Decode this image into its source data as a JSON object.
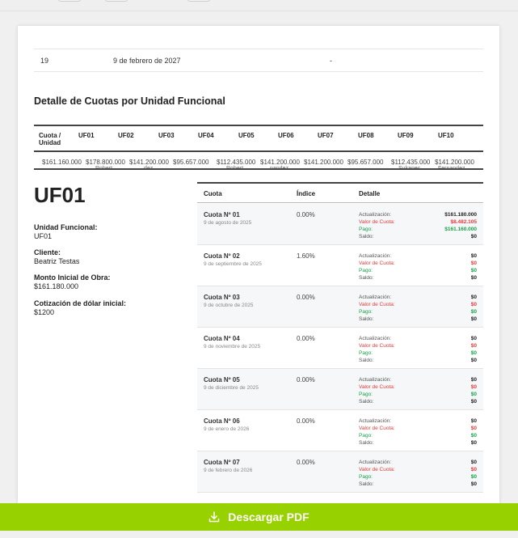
{
  "previous_row": {
    "number": "19",
    "date": "9 de febrero de 2027",
    "value": "-"
  },
  "section_title": "Detalle de Cuotas por Unidad Funcional",
  "uf_table": {
    "headers": [
      "Cuota / Unidad",
      "UF01",
      "UF02",
      "UF03",
      "UF04",
      "UF05",
      "UF06",
      "UF07",
      "UF08",
      "UF09",
      "UF10"
    ],
    "overlapped_values": [
      "$161.160.000",
      "$178.800.000",
      "$141.200.000",
      "$95.657.000",
      "$112.435.000",
      "$141.200.000",
      "$141.200.000",
      "$95.657.000",
      "$112.435.000",
      "$141.200.000"
    ],
    "overlapped_subtexts": [
      "Robert",
      "dez",
      "Robert",
      "nandez",
      "Sukanec",
      "Fernandez"
    ]
  },
  "unit": {
    "title": "UF01",
    "fields": [
      {
        "label": "Unidad Funcional:",
        "value": "UF01"
      },
      {
        "label": "Cliente:",
        "value": "Beatriz Testas"
      },
      {
        "label": "Monto Inicial de Obra:",
        "value": "$161.180.000"
      },
      {
        "label": "Cotización de dólar inicial:",
        "value": "$1200"
      }
    ]
  },
  "cuotas_table": {
    "headers": {
      "cuota": "Cuota",
      "indice": "Índice",
      "detalle": "Detalle"
    },
    "detail_labels": {
      "act": "Actualización:",
      "valor": "Valor de Cuota:",
      "pago": "Pago:",
      "saldo": "Saldo:"
    },
    "rows": [
      {
        "name": "Cuota Nº 01",
        "date": "9 de agosto de 2025",
        "index": "0.00%",
        "act": "$161.180.000",
        "valor": "$8.482.105",
        "pago": "$161.160.000",
        "saldo": "$0"
      },
      {
        "name": "Cuota Nº 02",
        "date": "9 de septiembre de 2025",
        "index": "1.60%",
        "act": "$0",
        "valor": "$0",
        "pago": "$0",
        "saldo": "$0"
      },
      {
        "name": "Cuota Nº 03",
        "date": "9 de octubre de 2025",
        "index": "0.00%",
        "act": "$0",
        "valor": "$0",
        "pago": "$0",
        "saldo": "$0"
      },
      {
        "name": "Cuota Nº 04",
        "date": "9 de noviembre de 2025",
        "index": "0.00%",
        "act": "$0",
        "valor": "$0",
        "pago": "$0",
        "saldo": "$0"
      },
      {
        "name": "Cuota Nº 05",
        "date": "9 de diciembre de 2025",
        "index": "0.00%",
        "act": "$0",
        "valor": "$0",
        "pago": "$0",
        "saldo": "$0"
      },
      {
        "name": "Cuota Nº 06",
        "date": "9 de enero de 2026",
        "index": "0.00%",
        "act": "$0",
        "valor": "$0",
        "pago": "$0",
        "saldo": "$0"
      },
      {
        "name": "Cuota Nº 07",
        "date": "9 de febrero de 2026",
        "index": "0.00%",
        "act": "$0",
        "valor": "$0",
        "pago": "$0",
        "saldo": "$0"
      }
    ]
  },
  "download": {
    "label": "Descargar PDF",
    "icon": "download-icon"
  },
  "colors": {
    "accent": "#97d100",
    "red": "#e03c3c",
    "green": "#18a24a"
  }
}
